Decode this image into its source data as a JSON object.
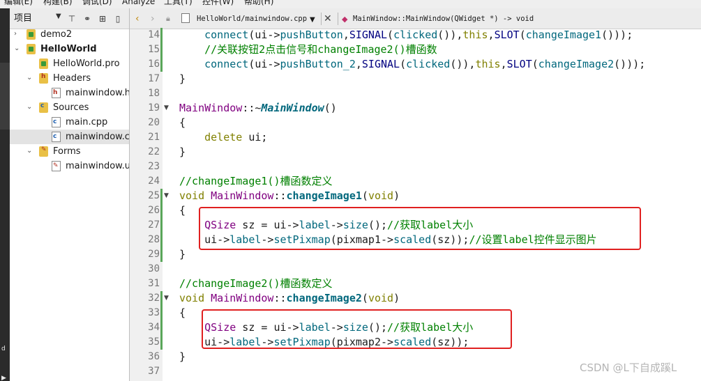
{
  "menubar": {
    "items": [
      "编辑(E)",
      "构建(B)",
      "调试(D)",
      "Analyze",
      "工具(T)",
      "控件(W)",
      "帮助(H)"
    ]
  },
  "project_panel": {
    "title": "项目",
    "tree": [
      {
        "label": "demo2",
        "expanded": false
      },
      {
        "label": "HelloWorld",
        "expanded": true,
        "bold": true
      },
      {
        "label": "HelloWorld.pro"
      },
      {
        "label": "Headers",
        "expanded": true
      },
      {
        "label": "mainwindow.h"
      },
      {
        "label": "Sources",
        "expanded": true
      },
      {
        "label": "main.cpp"
      },
      {
        "label": "mainwindow.cpp",
        "selected": true
      },
      {
        "label": "Forms",
        "expanded": true
      },
      {
        "label": "mainwindow.ui"
      }
    ]
  },
  "editor_toolbar": {
    "file": "HelloWorld/mainwindow.cpp",
    "symbol": "MainWindow::MainWindow(QWidget *) -> void"
  },
  "editor": {
    "line_numbers": [
      "14",
      "15",
      "16",
      "17",
      "18",
      "19",
      "20",
      "21",
      "22",
      "23",
      "24",
      "25",
      "26",
      "27",
      "28",
      "29",
      "30",
      "31",
      "32",
      "33",
      "34",
      "35",
      "36",
      "37"
    ],
    "lines": [
      [
        [
          "    ",
          ""
        ],
        [
          "connect",
          "t-fn"
        ],
        [
          "(ui->",
          ""
        ],
        [
          "pushButton",
          "t-fn"
        ],
        [
          ",",
          ""
        ],
        [
          "SIGNAL",
          "t-macro"
        ],
        [
          "(",
          ""
        ],
        [
          "clicked",
          "t-fn"
        ],
        [
          "()),",
          ""
        ],
        [
          "this",
          "t-kw"
        ],
        [
          ",",
          ""
        ],
        [
          "SLOT",
          "t-macro"
        ],
        [
          "(",
          ""
        ],
        [
          "changeImage1",
          "t-fn"
        ],
        [
          "()));",
          ""
        ]
      ],
      [
        [
          "    ",
          ""
        ],
        [
          "//关联按钮2点击信号和changeImage2()槽函数",
          "t-cm"
        ]
      ],
      [
        [
          "    ",
          ""
        ],
        [
          "connect",
          "t-fn"
        ],
        [
          "(ui->",
          ""
        ],
        [
          "pushButton_2",
          "t-fn"
        ],
        [
          ",",
          ""
        ],
        [
          "SIGNAL",
          "t-macro"
        ],
        [
          "(",
          ""
        ],
        [
          "clicked",
          "t-fn"
        ],
        [
          "()),",
          ""
        ],
        [
          "this",
          "t-kw"
        ],
        [
          ",",
          ""
        ],
        [
          "SLOT",
          "t-macro"
        ],
        [
          "(",
          ""
        ],
        [
          "changeImage2",
          "t-fn"
        ],
        [
          "()));",
          ""
        ]
      ],
      [
        [
          "}",
          ""
        ]
      ],
      [],
      [
        [
          "MainWindow",
          "t-type"
        ],
        [
          "::~",
          ""
        ],
        [
          "MainWindow",
          "t-dtor"
        ],
        [
          "()",
          ""
        ]
      ],
      [
        [
          "{",
          ""
        ]
      ],
      [
        [
          "    ",
          ""
        ],
        [
          "delete",
          "t-kw"
        ],
        [
          " ui;",
          ""
        ]
      ],
      [
        [
          "}",
          ""
        ]
      ],
      [],
      [
        [
          "//changeImage1()槽函数定义",
          "t-cm"
        ]
      ],
      [
        [
          "void",
          "t-kw"
        ],
        [
          " ",
          ""
        ],
        [
          "MainWindow",
          "t-type"
        ],
        [
          "::",
          ""
        ],
        [
          "changeImage1",
          "t-def"
        ],
        [
          "(",
          ""
        ],
        [
          "void",
          "t-kw"
        ],
        [
          ")",
          ""
        ]
      ],
      [
        [
          "{",
          ""
        ]
      ],
      [
        [
          "    ",
          ""
        ],
        [
          "QSize",
          "t-type"
        ],
        [
          " sz = ui->",
          ""
        ],
        [
          "label",
          "t-fn"
        ],
        [
          "->",
          ""
        ],
        [
          "size",
          "t-fn"
        ],
        [
          "();",
          ""
        ],
        [
          "//获取label大小",
          "t-cm"
        ]
      ],
      [
        [
          "    ",
          ""
        ],
        [
          "ui->",
          ""
        ],
        [
          "label",
          "t-fn"
        ],
        [
          "->",
          ""
        ],
        [
          "setPixmap",
          "t-fn"
        ],
        [
          "(pixmap1->",
          ""
        ],
        [
          "scaled",
          "t-fn"
        ],
        [
          "(sz));",
          ""
        ],
        [
          "//设置label控件显示图片",
          "t-cm"
        ]
      ],
      [
        [
          "}",
          ""
        ]
      ],
      [],
      [
        [
          "//changeImage2()槽函数定义",
          "t-cm"
        ]
      ],
      [
        [
          "void",
          "t-kw"
        ],
        [
          " ",
          ""
        ],
        [
          "MainWindow",
          "t-type"
        ],
        [
          "::",
          ""
        ],
        [
          "changeImage2",
          "t-def"
        ],
        [
          "(",
          ""
        ],
        [
          "void",
          "t-kw"
        ],
        [
          ")",
          ""
        ]
      ],
      [
        [
          "{",
          ""
        ]
      ],
      [
        [
          "    ",
          ""
        ],
        [
          "QSize",
          "t-type"
        ],
        [
          " sz = ui->",
          ""
        ],
        [
          "label",
          "t-fn"
        ],
        [
          "->",
          ""
        ],
        [
          "size",
          "t-fn"
        ],
        [
          "();",
          ""
        ],
        [
          "//获取label大小",
          "t-cm"
        ]
      ],
      [
        [
          "    ",
          ""
        ],
        [
          "ui->",
          ""
        ],
        [
          "label",
          "t-fn"
        ],
        [
          "->",
          ""
        ],
        [
          "setPixmap",
          "t-fn"
        ],
        [
          "(pixmap2->",
          ""
        ],
        [
          "scaled",
          "t-fn"
        ],
        [
          "(sz));",
          ""
        ]
      ],
      [
        [
          "}",
          ""
        ]
      ],
      []
    ]
  },
  "watermark": "CSDN @L下自成蹊L",
  "colors": {
    "highlight_box": "#e02020",
    "keyword": "#808000",
    "comment": "#008000",
    "function": "#00677c",
    "type": "#800080"
  }
}
